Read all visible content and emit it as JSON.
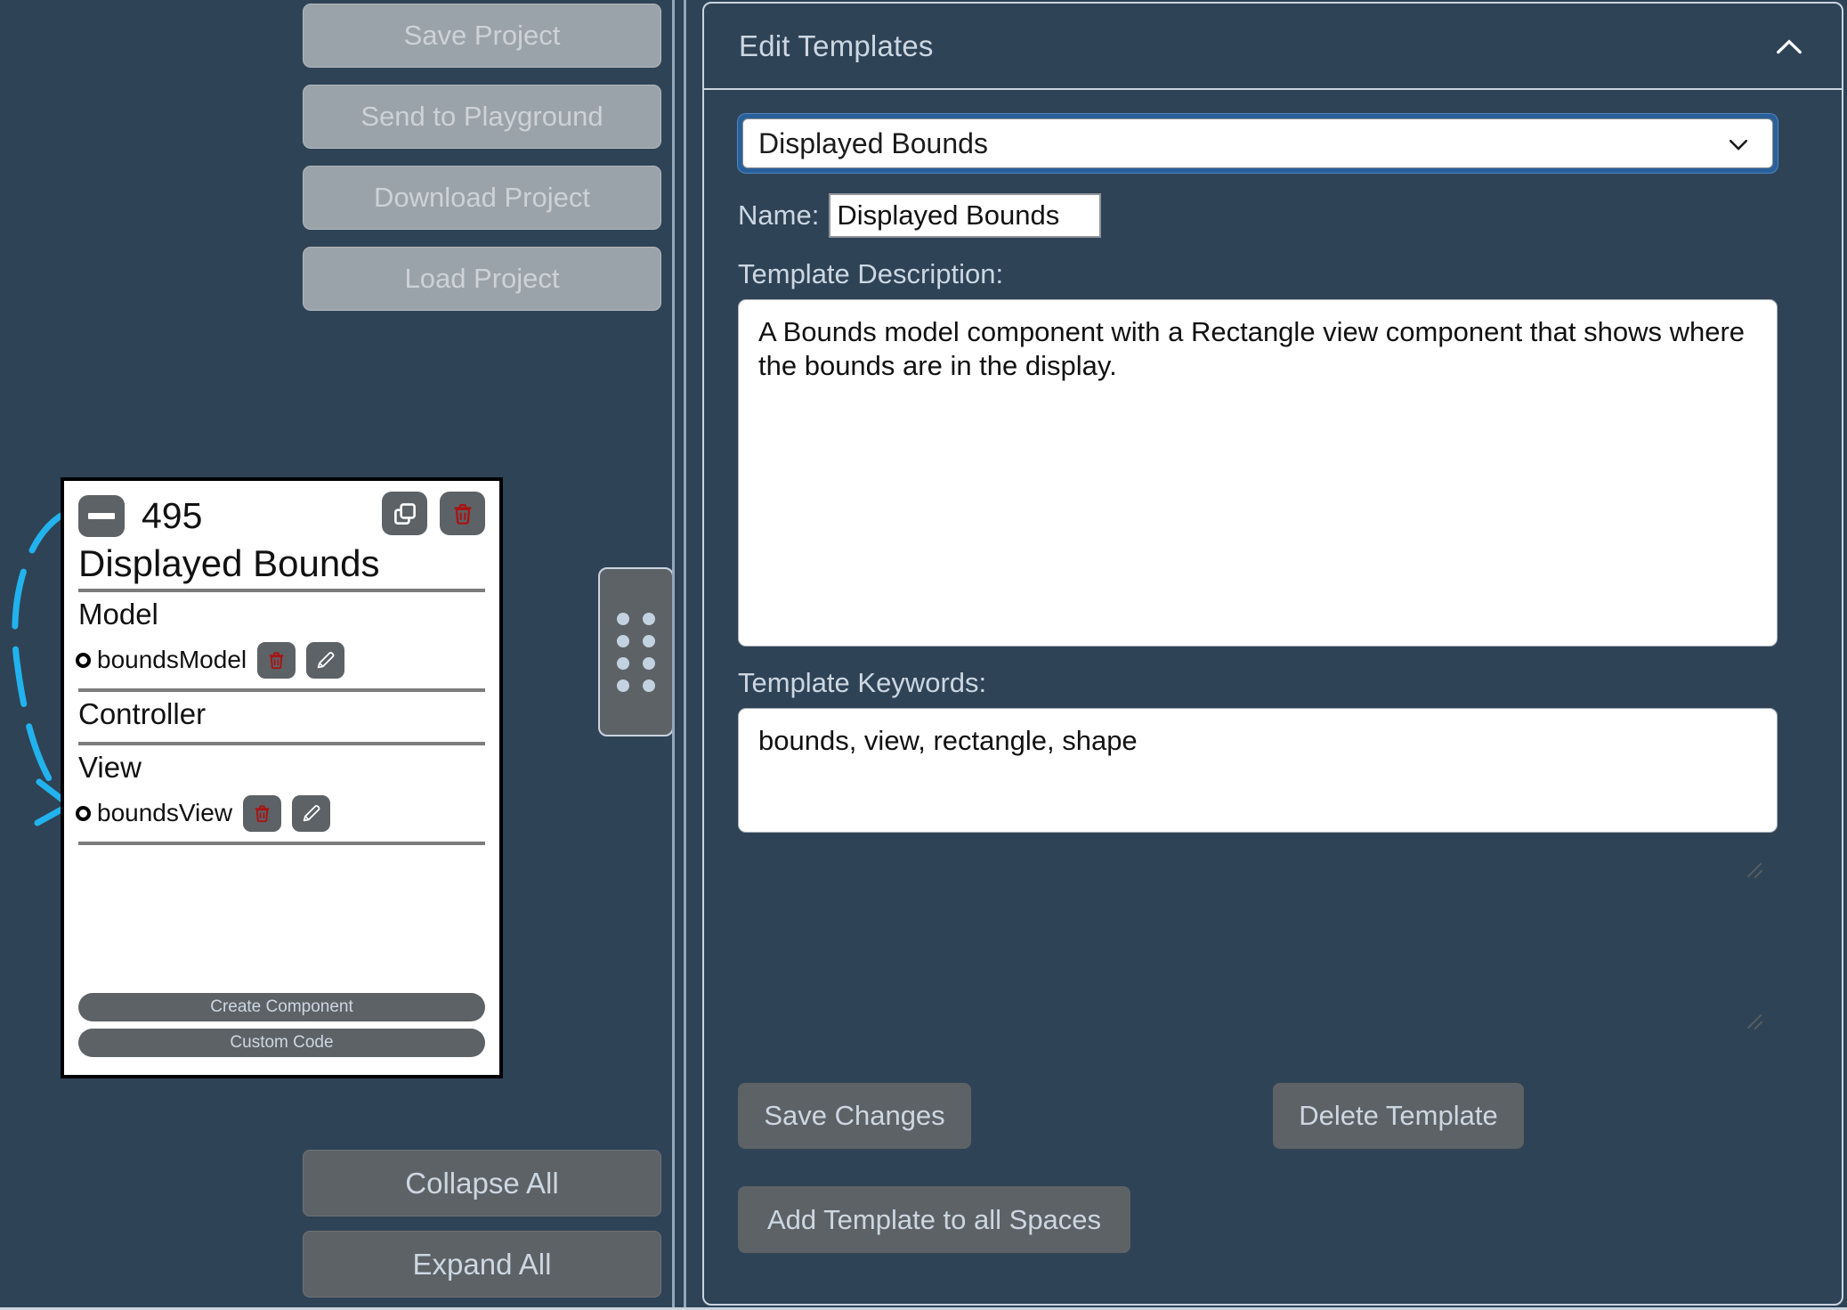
{
  "project_actions": {
    "save_project": "Save Project",
    "send_to_playground": "Send to Playground",
    "download_project": "Download Project",
    "load_project": "Load Project"
  },
  "bulk_actions": {
    "collapse_all": "Collapse All",
    "expand_all": "Expand All"
  },
  "component_card": {
    "id": "495",
    "title": "Displayed Bounds",
    "sections": [
      {
        "label": "Model",
        "members": [
          {
            "name": "boundsModel"
          }
        ]
      },
      {
        "label": "Controller",
        "members": []
      },
      {
        "label": "View",
        "members": [
          {
            "name": "boundsView"
          }
        ]
      }
    ],
    "model_label": "Model",
    "controller_label": "Controller",
    "view_label": "View",
    "model_member": "boundsModel",
    "view_member": "boundsView",
    "create_component": "Create Component",
    "custom_code": "Custom Code",
    "icons": {
      "minimize": "minus-icon",
      "copy": "copy-icon",
      "delete": "trash-icon",
      "row_delete": "trash-icon",
      "row_edit": "pencil-icon"
    }
  },
  "drag_handle": {
    "icon": "grip-dots-icon"
  },
  "edit_templates": {
    "title": "Edit Templates",
    "collapse_icon": "chevron-up-icon",
    "select": {
      "value": "Displayed Bounds",
      "chevron_icon": "chevron-down-icon",
      "options": [
        "Displayed Bounds"
      ]
    },
    "name_label": "Name:",
    "name_value": "Displayed Bounds",
    "description_label": "Template Description:",
    "description_value": "A Bounds model component with a Rectangle view component that shows where the bounds are in the display.",
    "keywords_label": "Template Keywords:",
    "keywords_value": "bounds, view, rectangle, shape",
    "save_changes": "Save Changes",
    "delete_template": "Delete Template",
    "add_template_all_spaces": "Add Template to all Spaces"
  },
  "colors": {
    "background": "#2f4356",
    "panel_border": "#c9d4df",
    "button_grey": "#5d6266",
    "button_text": "#ccd7e2",
    "disabled_button": "#9ba3aa",
    "accent_focus": "#2a6099",
    "connector": "#22b3ef",
    "danger": "#a81414"
  }
}
